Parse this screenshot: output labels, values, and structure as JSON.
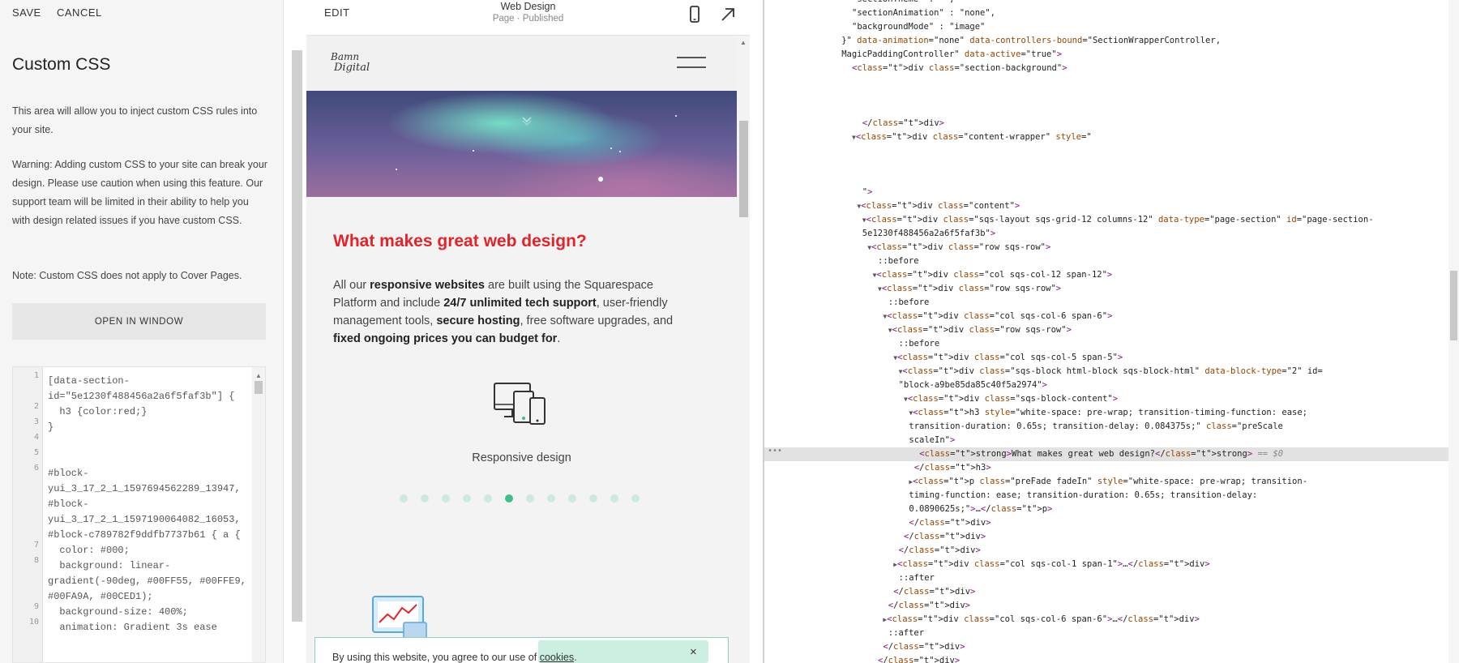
{
  "editor_panel": {
    "save_label": "SAVE",
    "cancel_label": "CANCEL",
    "title": "Custom CSS",
    "description": "This area will allow you to inject custom CSS rules into your site.",
    "warning": "Warning: Adding custom CSS to your site can break your design. Please use caution when using this feature. Our support team will be limited in their ability to help you with design related issues if you have custom CSS.",
    "note": "Note: Custom CSS does not apply to Cover Pages.",
    "open_window_label": "OPEN IN WINDOW",
    "code_lines": [
      {
        "n": "1",
        "text": "[data-section-"
      },
      {
        "n": "",
        "text": "id=\"5e1230f488456a2a6f5faf3b\"] {"
      },
      {
        "n": "2",
        "text": "  h3 {color:red;}"
      },
      {
        "n": "3",
        "text": "}"
      },
      {
        "n": "4",
        "text": ""
      },
      {
        "n": "5",
        "text": ""
      },
      {
        "n": "6",
        "text": "#block-"
      },
      {
        "n": "",
        "text": "yui_3_17_2_1_1597694562289_13947,"
      },
      {
        "n": "",
        "text": "#block-"
      },
      {
        "n": "",
        "text": "yui_3_17_2_1_1597190064082_16053,"
      },
      {
        "n": "",
        "text": "#block-c789782f9ddfb7737b61 { a {"
      },
      {
        "n": "7",
        "text": "  color: #000;"
      },
      {
        "n": "8",
        "text": "  background: linear-"
      },
      {
        "n": "",
        "text": "gradient(-90deg, #00FF55, #00FFE9,"
      },
      {
        "n": "",
        "text": "#00FA9A, #00CED1);"
      },
      {
        "n": "9",
        "text": "  background-size: 400%;"
      },
      {
        "n": "10",
        "text": "  animation: Gradient 3s ease"
      }
    ]
  },
  "preview": {
    "edit_label": "EDIT",
    "page_title": "Web Design",
    "page_status": "Page · Published",
    "logo_line1": "Bamn",
    "logo_line2": "Digital",
    "heading": "What makes great web design?",
    "body_parts": [
      "All our ",
      "responsive websites",
      " are built using the Squarespace Platform and include ",
      "24/7 unlimited tech support",
      ", user-friendly management tools, ",
      "secure hosting",
      ", free software upgrades, and ",
      "fixed ongoing prices you can budget for",
      "."
    ],
    "feature_caption": "Responsive design",
    "slider_total": 12,
    "slider_active_index": 5,
    "cookie_text_before": "By using this website, you agree to our use of ",
    "cookie_link": "cookies",
    "cookie_text_after": ".",
    "cookie_close": "×"
  },
  "devtools": {
    "lines": [
      {
        "indent": 15,
        "text": "\"sectionTheme\" : \"\","
      },
      {
        "indent": 15,
        "text": "\"sectionAnimation\" : \"none\","
      },
      {
        "indent": 15,
        "text": "\"backgroundMode\" : \"image\""
      },
      {
        "indent": 13,
        "text": "}\" data-animation=\"none\" data-controllers-bound=\"SectionWrapperController,"
      },
      {
        "indent": 13,
        "text": "MagicPaddingController\" data-active=\"true\">"
      },
      {
        "indent": 15,
        "text": "<div class=\"section-background\">"
      },
      {
        "indent": 0,
        "text": ""
      },
      {
        "indent": 0,
        "text": ""
      },
      {
        "indent": 0,
        "text": ""
      },
      {
        "indent": 17,
        "text": "</div>"
      },
      {
        "indent": 15,
        "text": "▼<div class=\"content-wrapper\" style=\""
      },
      {
        "indent": 0,
        "text": ""
      },
      {
        "indent": 0,
        "text": ""
      },
      {
        "indent": 0,
        "text": ""
      },
      {
        "indent": 17,
        "text": "\">"
      },
      {
        "indent": 16,
        "text": "▼<div class=\"content\">"
      },
      {
        "indent": 17,
        "text": "▼<div class=\"sqs-layout sqs-grid-12 columns-12\" data-type=\"page-section\" id=\"page-section-"
      },
      {
        "indent": 17,
        "text": "5e1230f488456a2a6f5faf3b\">"
      },
      {
        "indent": 18,
        "text": "▼<div class=\"row sqs-row\">"
      },
      {
        "indent": 20,
        "text": "::before"
      },
      {
        "indent": 19,
        "text": "▼<div class=\"col sqs-col-12 span-12\">"
      },
      {
        "indent": 20,
        "text": "▼<div class=\"row sqs-row\">"
      },
      {
        "indent": 22,
        "text": "::before"
      },
      {
        "indent": 21,
        "text": "▼<div class=\"col sqs-col-6 span-6\">"
      },
      {
        "indent": 22,
        "text": "▼<div class=\"row sqs-row\">"
      },
      {
        "indent": 24,
        "text": "::before"
      },
      {
        "indent": 23,
        "text": "▼<div class=\"col sqs-col-5 span-5\">"
      },
      {
        "indent": 24,
        "text": "▼<div class=\"sqs-block html-block sqs-block-html\" data-block-type=\"2\" id="
      },
      {
        "indent": 24,
        "text": "\"block-a9be85da85c40f5a2974\">"
      },
      {
        "indent": 25,
        "text": "▼<div class=\"sqs-block-content\">"
      },
      {
        "indent": 26,
        "text": "▼<h3 style=\"white-space: pre-wrap; transition-timing-function: ease;"
      },
      {
        "indent": 26,
        "text": "transition-duration: 0.65s; transition-delay: 0.084375s;\" class=\"preScale"
      },
      {
        "indent": 26,
        "text": "scaleIn\">"
      },
      {
        "indent": 28,
        "text": "<strong>What makes great web design?</strong> == $0",
        "highlight": true
      },
      {
        "indent": 27,
        "text": "</h3>"
      },
      {
        "indent": 26,
        "text": "▶<p class=\"preFade fadeIn\" style=\"white-space: pre-wrap; transition-"
      },
      {
        "indent": 26,
        "text": "timing-function: ease; transition-duration: 0.65s; transition-delay:"
      },
      {
        "indent": 26,
        "text": "0.0890625s;\">…</p>"
      },
      {
        "indent": 26,
        "text": "</div>"
      },
      {
        "indent": 25,
        "text": "</div>"
      },
      {
        "indent": 24,
        "text": "</div>"
      },
      {
        "indent": 23,
        "text": "▶<div class=\"col sqs-col-1 span-1\">…</div>"
      },
      {
        "indent": 24,
        "text": "::after"
      },
      {
        "indent": 23,
        "text": "</div>"
      },
      {
        "indent": 22,
        "text": "</div>"
      },
      {
        "indent": 21,
        "text": "▶<div class=\"col sqs-col-6 span-6\">…</div>"
      },
      {
        "indent": 22,
        "text": "::after"
      },
      {
        "indent": 21,
        "text": "</div>"
      },
      {
        "indent": 20,
        "text": "</div>"
      }
    ],
    "gutter_ellipsis": "•••"
  }
}
